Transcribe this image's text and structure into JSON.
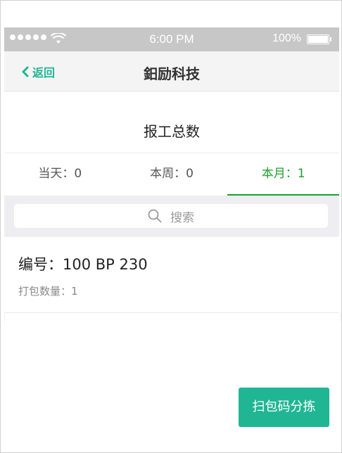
{
  "status_bar": {
    "time": "6:00 PM",
    "battery": "100%",
    "signal_icon": "signal-dots-icon",
    "wifi_icon": "wifi-icon",
    "battery_icon": "battery-icon"
  },
  "nav": {
    "back_label": "返回",
    "back_icon": "chevron-left-icon",
    "title": "鈤励科技"
  },
  "summary": {
    "title": "报工总数",
    "tabs": [
      {
        "label": "当天：0",
        "active": false
      },
      {
        "label": "本周：0",
        "active": false
      },
      {
        "label": "本月：1",
        "active": true
      }
    ]
  },
  "search": {
    "placeholder": "搜索",
    "icon": "search-icon"
  },
  "items": [
    {
      "code": "编号：100 BP 230",
      "qty": "打包数量：1"
    }
  ],
  "actions": {
    "scan_label": "扫包码分拣"
  },
  "colors": {
    "accent": "#20b694",
    "tab_active": "#1aa12c",
    "status_bar_bg": "#c7c7c7"
  }
}
